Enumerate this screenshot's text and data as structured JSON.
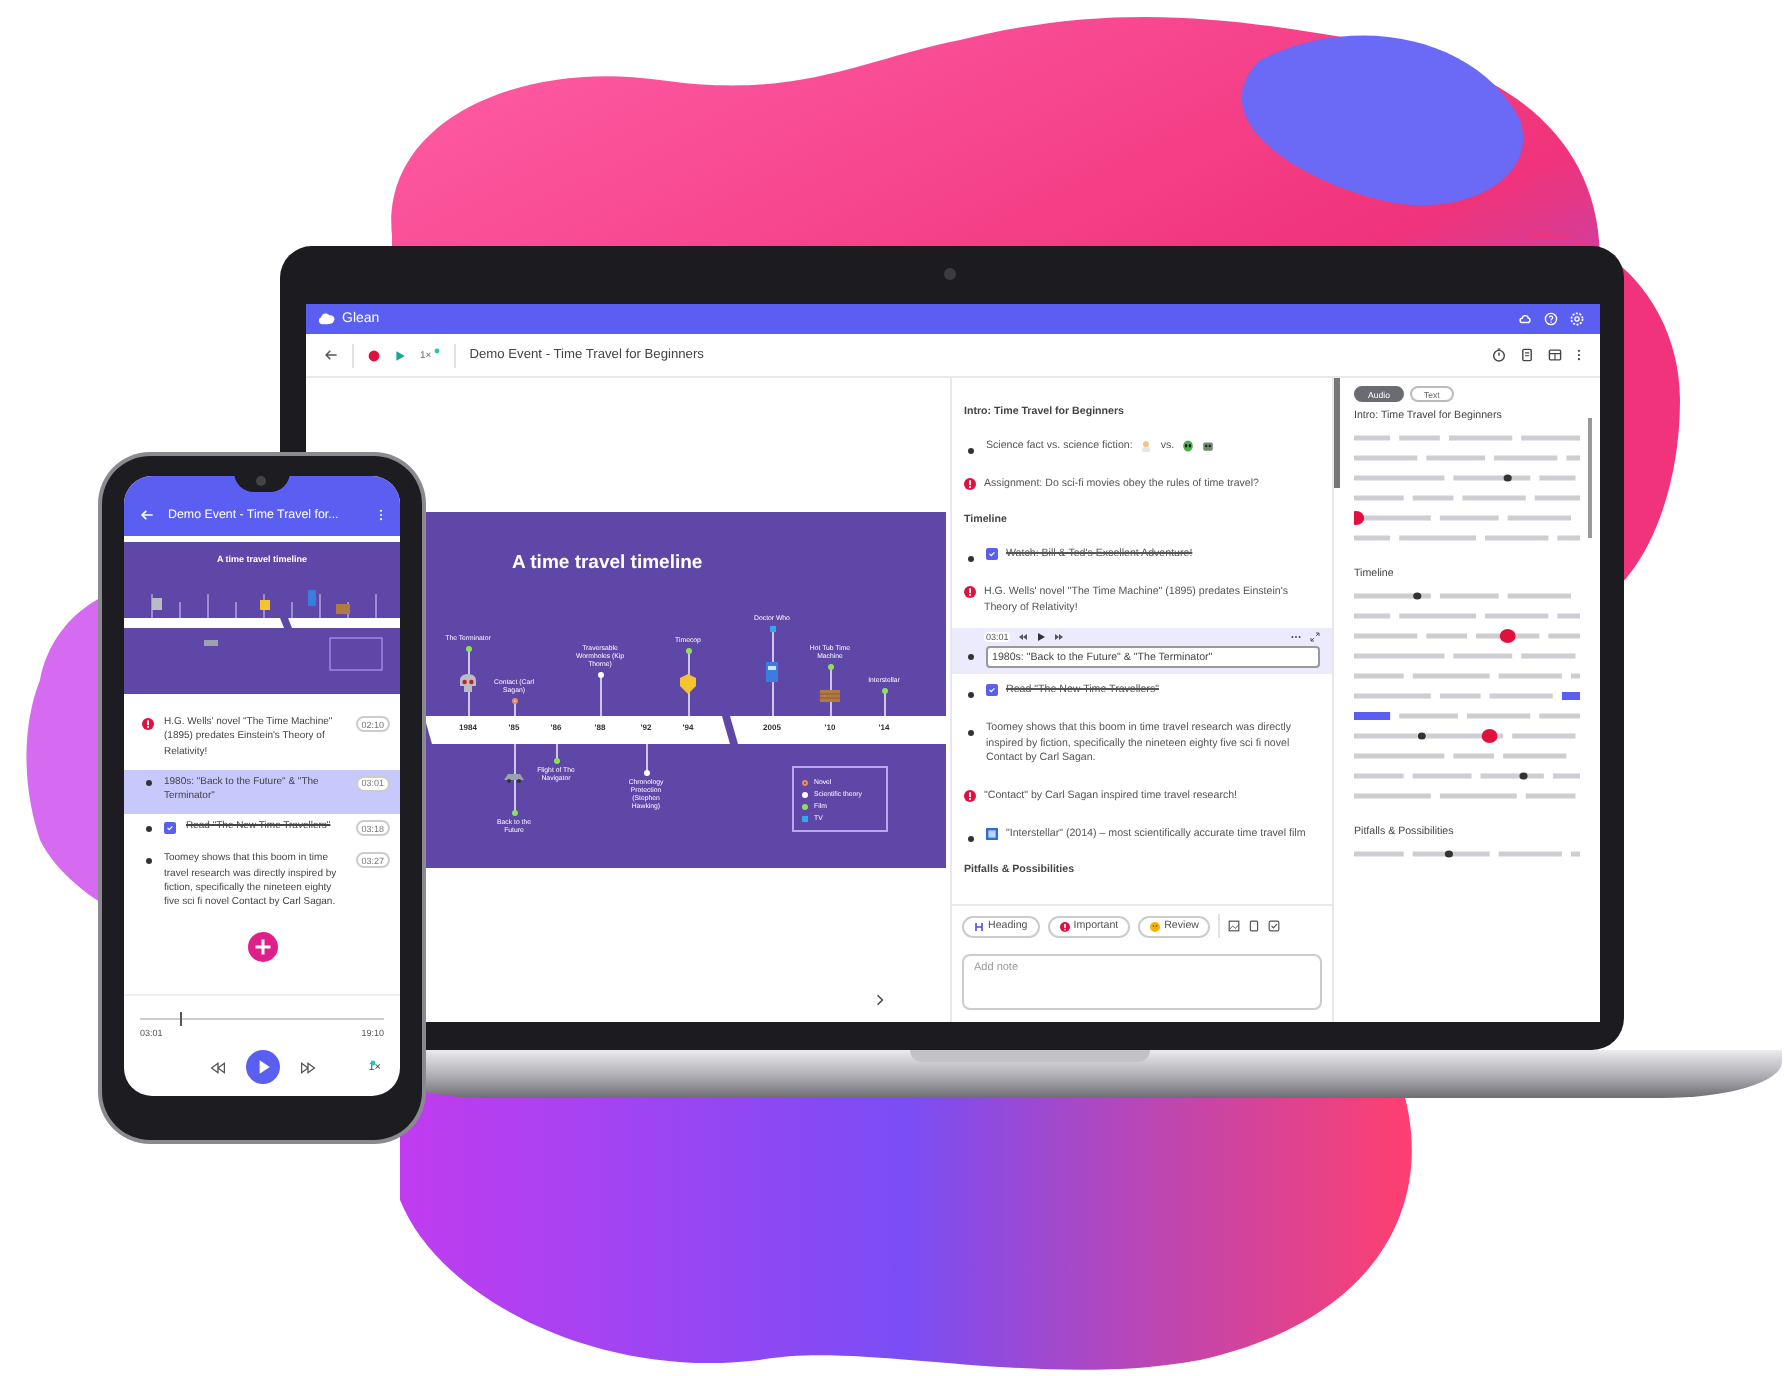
{
  "app": {
    "name": "Glean"
  },
  "laptop": {
    "toolbar": {
      "speed": "1×",
      "title": "Demo Event - Time Travel for Beginners"
    },
    "slide": {
      "title": "A time travel timeline",
      "years": [
        {
          "label": "1984",
          "above": [
            {
              "label": "The Terminator",
              "kind": "film",
              "picture": {
                "kind": "skull"
              }
            }
          ]
        },
        {
          "label": "'85",
          "above": [
            {
              "label": "Contact (Carl Sagan)",
              "kind": "novel"
            }
          ],
          "below": [
            {
              "label": "Back to the Future",
              "kind": "film",
              "picture": {
                "kind": "car"
              }
            }
          ]
        },
        {
          "label": "'86",
          "below": [
            {
              "label": "Flight of The Navigator",
              "kind": "film"
            }
          ]
        },
        {
          "label": "'88",
          "above": [
            {
              "label": "Traversable Wormholes (Kip Thorne)",
              "kind": "theory"
            }
          ]
        },
        {
          "label": "'92",
          "below": [
            {
              "label": "Chronology Protection (Stephen Hawking)",
              "kind": "theory"
            }
          ]
        },
        {
          "label": "'94",
          "above": [
            {
              "label": "Timecop",
              "kind": "film",
              "picture": {
                "kind": "badge"
              }
            }
          ]
        },
        {
          "label": "2005",
          "above": [
            {
              "label": "Doctor Who",
              "kind": "tv",
              "picture": {
                "kind": "police-box"
              }
            }
          ]
        },
        {
          "label": "'10",
          "above": [
            {
              "label": "Hot Tub Time Machine",
              "kind": "film",
              "picture": {
                "kind": "crate"
              }
            }
          ]
        },
        {
          "label": "'14",
          "above": [
            {
              "label": "Interstellar",
              "kind": "film"
            }
          ]
        }
      ],
      "legend": [
        {
          "label": "Novel",
          "kind": "novel"
        },
        {
          "label": "Scientific theory",
          "kind": "theory"
        },
        {
          "label": "Film",
          "kind": "film"
        },
        {
          "label": "TV",
          "kind": "tv"
        }
      ]
    },
    "notes": [
      {
        "kind": "heading",
        "text": "Intro: Time Travel for Beginners"
      },
      {
        "kind": "comparison",
        "text": "Science fact vs. science fiction:",
        "joiner": "vs."
      },
      {
        "kind": "important",
        "text": "Assignment: Do sci-fi movies obey the rules of time travel?"
      },
      {
        "kind": "heading",
        "text": "Timeline"
      },
      {
        "kind": "task",
        "checked": true,
        "text": "Watch: Bill & Ted's Excellent Adventure!"
      },
      {
        "kind": "important",
        "text": "H.G. Wells' novel \"The Time Machine\" (1895) predates Einstein's Theory of Relativity!"
      },
      {
        "kind": "editing",
        "time": "03:01",
        "value": "1980s: \"Back to the Future\" & \"The Terminator\""
      },
      {
        "kind": "task",
        "checked": true,
        "text": "Read \"The New Time Travellers\""
      },
      {
        "kind": "bullet",
        "text": "Toomey shows that this boom in time travel research was directly inspired by fiction, specifically the nineteen eighty five sci fi novel Contact by Carl Sagan."
      },
      {
        "kind": "important",
        "text": "\"Contact\" by Carl Sagan inspired time travel research!"
      },
      {
        "kind": "media",
        "text": "\"Interstellar\" (2014) – most scientifically accurate time travel film"
      },
      {
        "kind": "heading",
        "text": "Pitfalls & Possibilities"
      }
    ],
    "note_tools": {
      "chips": [
        {
          "kind": "heading",
          "label": "Heading"
        },
        {
          "kind": "important",
          "label": "Important"
        },
        {
          "kind": "review",
          "label": "Review"
        }
      ],
      "placeholder": "Add note"
    },
    "transcript": {
      "modes": [
        {
          "label": "Audio",
          "selected": true
        },
        {
          "label": "Text",
          "selected": false
        }
      ],
      "sections": [
        "Intro: Time Travel for Beginners",
        "Timeline",
        "Pitfalls & Possibilities"
      ]
    }
  },
  "phone": {
    "title": "Demo Event - Time Travel for...",
    "slide_title": "A time travel timeline",
    "notes": [
      {
        "kind": "important",
        "text": "H.G. Wells' novel \"The Time Machine\" (1895) predates Einstein's Theory of Relativity!",
        "time": "02:10",
        "selected": false
      },
      {
        "kind": "bullet",
        "text": "1980s: \"Back to the Future\" & \"The Terminator\"",
        "time": "03:01",
        "selected": true
      },
      {
        "kind": "task",
        "checked": true,
        "text": "Read \"The New Time Travellers\"",
        "time": "03:18",
        "selected": false
      },
      {
        "kind": "bullet",
        "text": "Toomey shows that this boom in time travel research was directly inspired by fiction, specifically the nineteen eighty five sci fi novel Contact by Carl Sagan.",
        "time": "03:27",
        "selected": false
      }
    ],
    "player": {
      "level": 0.16,
      "elapsed": "03:01",
      "total": "19:10",
      "speed": "1×"
    }
  }
}
